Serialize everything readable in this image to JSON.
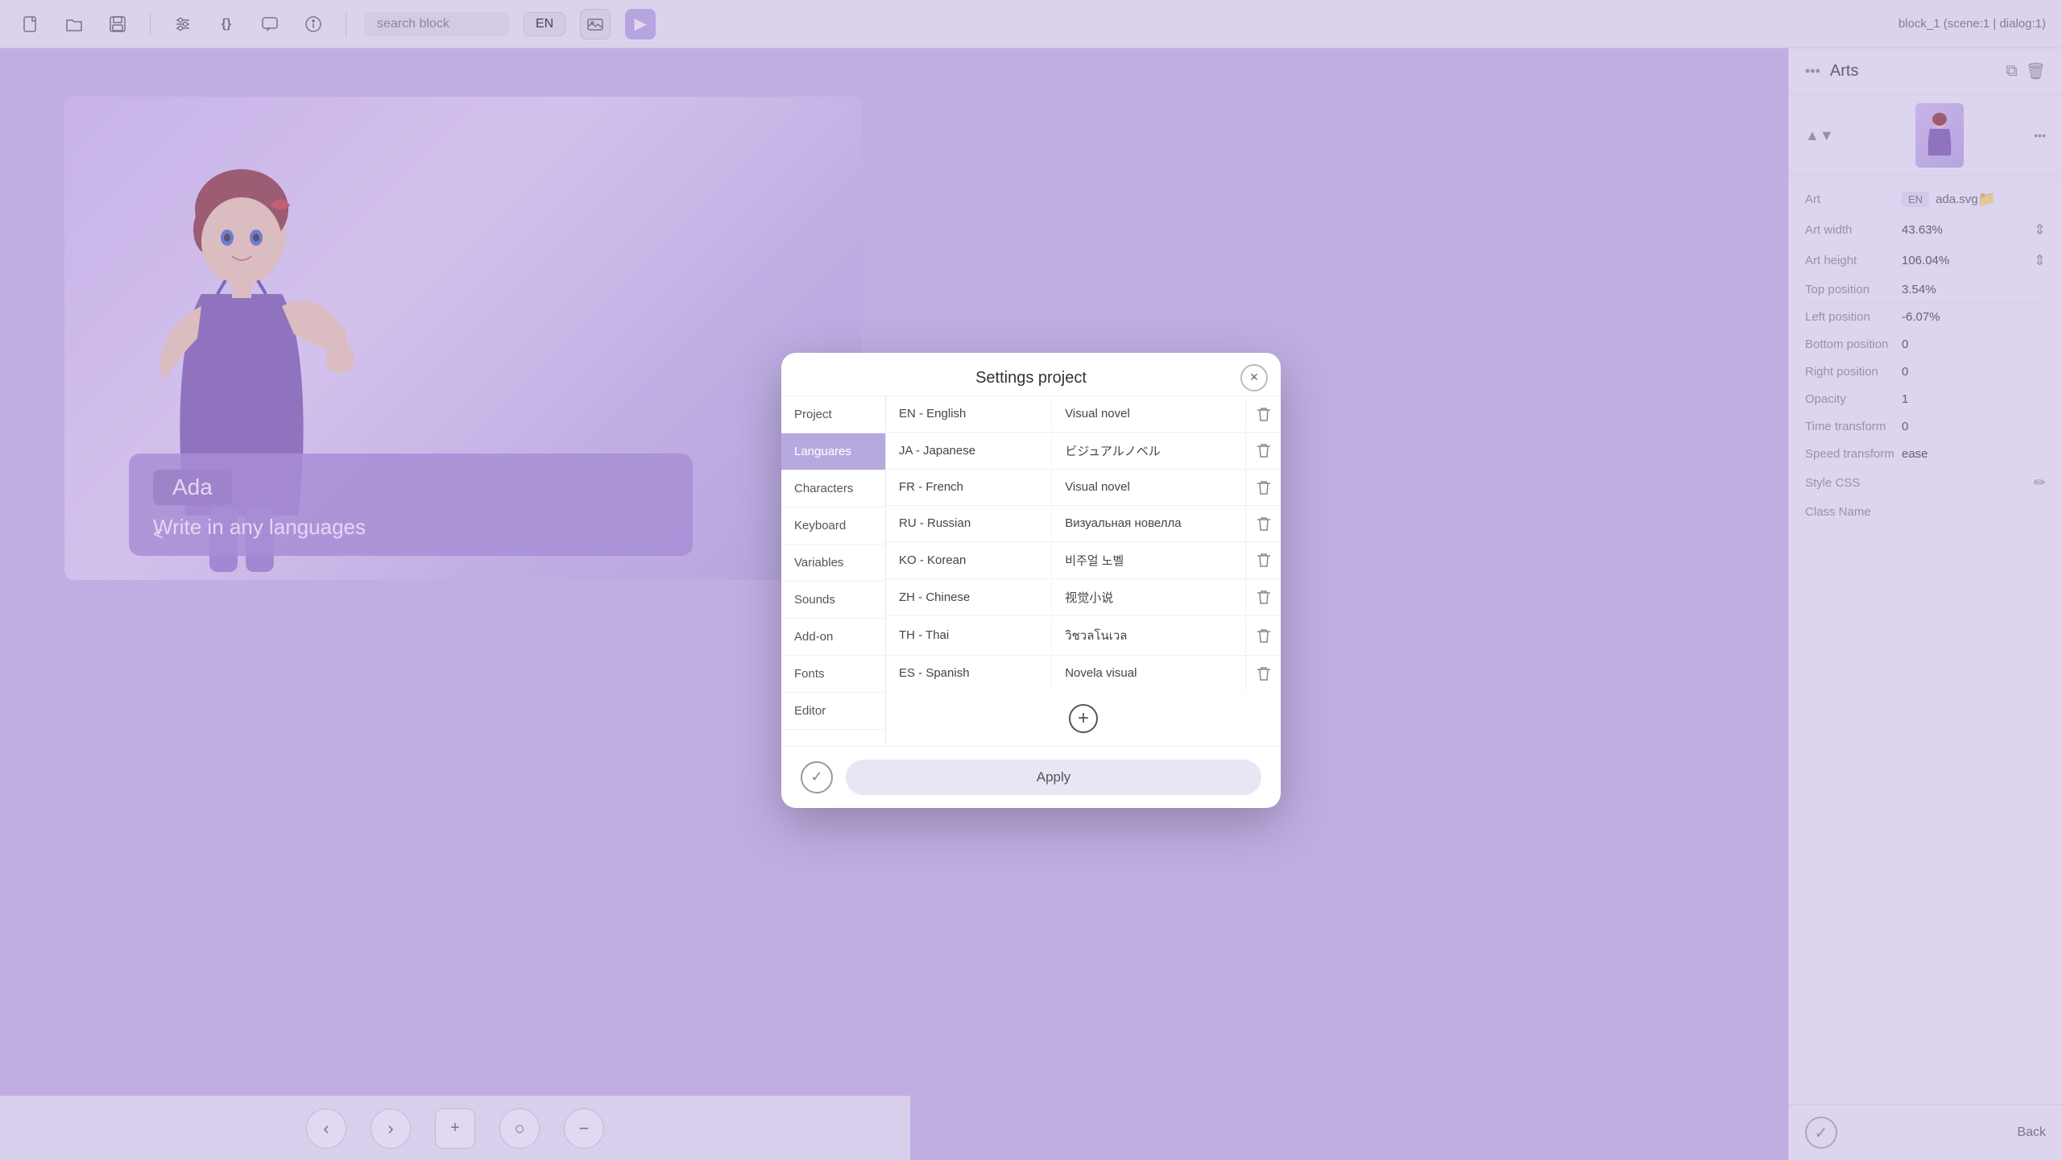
{
  "toolbar": {
    "search_placeholder": "search block",
    "lang_btn": "EN",
    "title": "block_1 (scene:1 | dialog:1)"
  },
  "canvas": {
    "character_name": "Ada",
    "dialog_text": "Write in any languages",
    "dialog_arrow": "<"
  },
  "right_panel": {
    "title": "Arts",
    "art_label": "Art",
    "art_lang": "EN",
    "art_filename": "ada.svg",
    "art_width_label": "Art width",
    "art_width_value": "43.63%",
    "art_height_label": "Art height",
    "art_height_value": "106.04%",
    "top_position_label": "Top position",
    "top_position_value": "3.54%",
    "left_position_label": "Left position",
    "left_position_value": "-6.07%",
    "bottom_position_label": "Bottom position",
    "bottom_position_value": "0",
    "right_position_label": "Right position",
    "right_position_value": "0",
    "opacity_label": "Opacity",
    "opacity_value": "1",
    "time_transform_label": "Time transform",
    "time_transform_value": "0",
    "speed_transform_label": "Speed transform",
    "speed_transform_value": "ease",
    "style_css_label": "Style CSS",
    "class_name_label": "Class Name",
    "back_label": "Back"
  },
  "modal": {
    "title": "Settings project",
    "sidebar_items": [
      {
        "id": "project",
        "label": "Project"
      },
      {
        "id": "languares",
        "label": "Languares",
        "active": true
      },
      {
        "id": "characters",
        "label": "Characters"
      },
      {
        "id": "keyboard",
        "label": "Keyboard"
      },
      {
        "id": "variables",
        "label": "Variables"
      },
      {
        "id": "sounds",
        "label": "Sounds"
      },
      {
        "id": "addon",
        "label": "Add-on"
      },
      {
        "id": "fonts",
        "label": "Fonts"
      },
      {
        "id": "editor",
        "label": "Editor"
      }
    ],
    "languages": [
      {
        "code": "EN - English",
        "translation": "Visual novel"
      },
      {
        "code": "JA - Japanese",
        "translation": "ビジュアルノベル"
      },
      {
        "code": "FR - French",
        "translation": "Visual novel"
      },
      {
        "code": "RU - Russian",
        "translation": "Визуальная новелла"
      },
      {
        "code": "KO - Korean",
        "translation": "비주얼 노벨"
      },
      {
        "code": "ZH - Chinese",
        "translation": "视觉小说"
      },
      {
        "code": "TH - Thai",
        "translation": "วิชวลโนเวล"
      },
      {
        "code": "ES - Spanish",
        "translation": "Novela visual"
      }
    ],
    "apply_label": "Apply",
    "close_label": "×"
  },
  "bottom_bar": {
    "prev": "‹",
    "next": "›",
    "add": "+",
    "circle": "○",
    "minus": "−"
  },
  "icons": {
    "new_file": "🗋",
    "open_folder": "📂",
    "save": "💾",
    "settings": "⚙",
    "code": "{}",
    "upload": "⬆",
    "info": "ℹ",
    "image": "🖼",
    "play": "▶",
    "copy": "⧉",
    "trash": "🗑",
    "pencil": "✏",
    "check": "✓",
    "up_arrow": "▲",
    "down_arrow": "▼"
  }
}
